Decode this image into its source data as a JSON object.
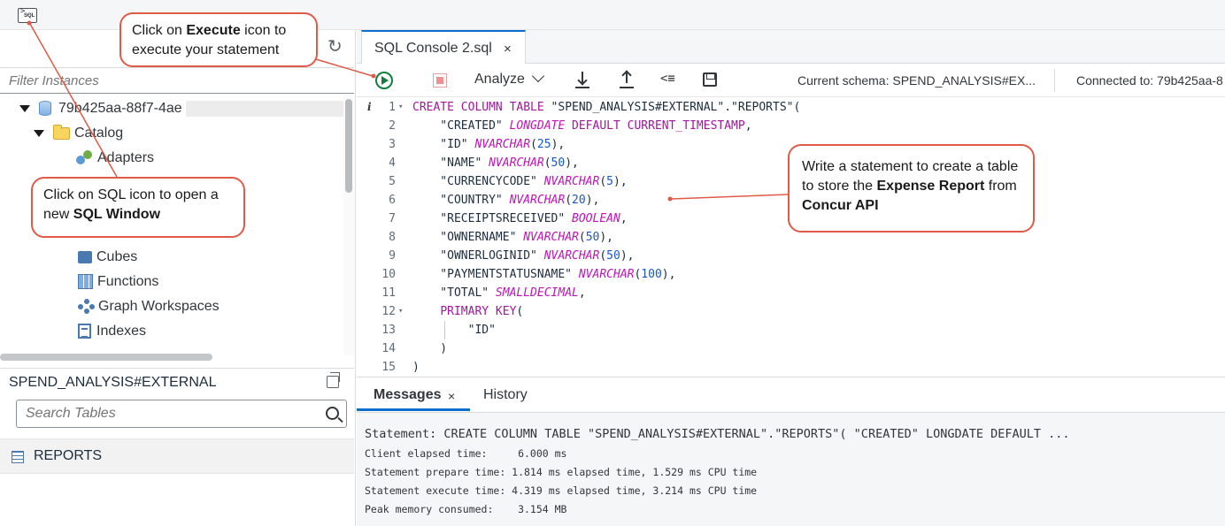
{
  "toolbar_icons": {
    "sql_open": "sql-console-icon",
    "refresh": "refresh-icon"
  },
  "left": {
    "filter_placeholder": "Filter Instances",
    "tree": {
      "instance": "79b425aa-88f7-4ae",
      "catalog": "Catalog",
      "items": [
        "Adapters",
        "Cubes",
        "Functions",
        "Graph Workspaces",
        "Indexes"
      ]
    },
    "schema": "SPEND_ANALYSIS#EXTERNAL",
    "search_placeholder": "Search Tables",
    "tables": [
      "REPORTS"
    ]
  },
  "editor": {
    "tab_title": "SQL Console 2.sql",
    "tab_close": "×",
    "analyze_label": "Analyze",
    "current_schema": "Current schema: SPEND_ANALYSIS#EX...",
    "connected_to": "Connected to: 79b425aa-8",
    "line_numbers": [
      "1",
      "2",
      "3",
      "4",
      "5",
      "6",
      "7",
      "8",
      "9",
      "10",
      "11",
      "12",
      "13",
      "14",
      "15"
    ],
    "code_lines": [
      [
        {
          "t": "kw",
          "v": "CREATE COLUMN TABLE"
        },
        {
          "t": "",
          "v": " \"SPEND_ANALYSIS#EXTERNAL\".\"REPORTS\"("
        }
      ],
      [
        {
          "t": "",
          "v": "    \"CREATED\" "
        },
        {
          "t": "ty",
          "v": "LONGDATE"
        },
        {
          "t": "",
          "v": " "
        },
        {
          "t": "kw",
          "v": "DEFAULT CURRENT_TIMESTAMP"
        },
        {
          "t": "",
          "v": ","
        }
      ],
      [
        {
          "t": "",
          "v": "    \"ID\" "
        },
        {
          "t": "ty",
          "v": "NVARCHAR"
        },
        {
          "t": "",
          "v": "("
        },
        {
          "t": "num",
          "v": "25"
        },
        {
          "t": "",
          "v": "),"
        }
      ],
      [
        {
          "t": "",
          "v": "    \"NAME\" "
        },
        {
          "t": "ty",
          "v": "NVARCHAR"
        },
        {
          "t": "",
          "v": "("
        },
        {
          "t": "num",
          "v": "50"
        },
        {
          "t": "",
          "v": "),"
        }
      ],
      [
        {
          "t": "",
          "v": "    \"CURRENCYCODE\" "
        },
        {
          "t": "ty",
          "v": "NVARCHAR"
        },
        {
          "t": "",
          "v": "("
        },
        {
          "t": "num",
          "v": "5"
        },
        {
          "t": "",
          "v": "),"
        }
      ],
      [
        {
          "t": "",
          "v": "    \"COUNTRY\" "
        },
        {
          "t": "ty",
          "v": "NVARCHAR"
        },
        {
          "t": "",
          "v": "("
        },
        {
          "t": "num",
          "v": "20"
        },
        {
          "t": "",
          "v": "),"
        }
      ],
      [
        {
          "t": "",
          "v": "    \"RECEIPTSRECEIVED\" "
        },
        {
          "t": "ty",
          "v": "BOOLEAN"
        },
        {
          "t": "",
          "v": ","
        }
      ],
      [
        {
          "t": "",
          "v": "    \"OWNERNAME\" "
        },
        {
          "t": "ty",
          "v": "NVARCHAR"
        },
        {
          "t": "",
          "v": "("
        },
        {
          "t": "num",
          "v": "50"
        },
        {
          "t": "",
          "v": "),"
        }
      ],
      [
        {
          "t": "",
          "v": "    \"OWNERLOGINID\" "
        },
        {
          "t": "ty",
          "v": "NVARCHAR"
        },
        {
          "t": "",
          "v": "("
        },
        {
          "t": "num",
          "v": "50"
        },
        {
          "t": "",
          "v": "),"
        }
      ],
      [
        {
          "t": "",
          "v": "    \"PAYMENTSTATUSNAME\" "
        },
        {
          "t": "ty",
          "v": "NVARCHAR"
        },
        {
          "t": "",
          "v": "("
        },
        {
          "t": "num",
          "v": "100"
        },
        {
          "t": "",
          "v": "),"
        }
      ],
      [
        {
          "t": "",
          "v": "    \"TOTAL\" "
        },
        {
          "t": "ty",
          "v": "SMALLDECIMAL"
        },
        {
          "t": "",
          "v": ","
        }
      ],
      [
        {
          "t": "",
          "v": "    "
        },
        {
          "t": "kw",
          "v": "PRIMARY KEY"
        },
        {
          "t": "",
          "v": "("
        }
      ],
      [
        {
          "t": "",
          "v": "        \"ID\""
        }
      ],
      [
        {
          "t": "",
          "v": "    )"
        }
      ],
      [
        {
          "t": "",
          "v": ")"
        }
      ]
    ]
  },
  "messages": {
    "tab_label": "Messages",
    "tab_close": "×",
    "history_label": "History",
    "statement": "Statement: CREATE COLUMN TABLE \"SPEND_ANALYSIS#EXTERNAL\".\"REPORTS\"( \"CREATED\" LONGDATE DEFAULT ...",
    "client_elapsed": "Client elapsed time:     6.000 ms",
    "prepare_time": "Statement prepare time: 1.814 ms elapsed time, 1.529 ms CPU time",
    "execute_time": "Statement execute time: 4.319 ms elapsed time, 3.214 ms CPU time",
    "peak_memory": "Peak memory consumed:    3.154 MB"
  },
  "callouts": {
    "execute": {
      "pre": "Click on ",
      "bold": "Execute",
      "post": " icon to execute your statement"
    },
    "sql": {
      "pre": "Click on SQL icon to open a new ",
      "bold": "SQL Window"
    },
    "statement": {
      "pre": "Write a statement to create a table to store the ",
      "bold1": "Expense Report",
      "mid": " from ",
      "bold2": "Concur API"
    }
  },
  "colors": {
    "callout_border": "#e05a48",
    "accent": "#0a6ed1",
    "keyword": "#a0179c",
    "execute_green": "#107e3e"
  }
}
